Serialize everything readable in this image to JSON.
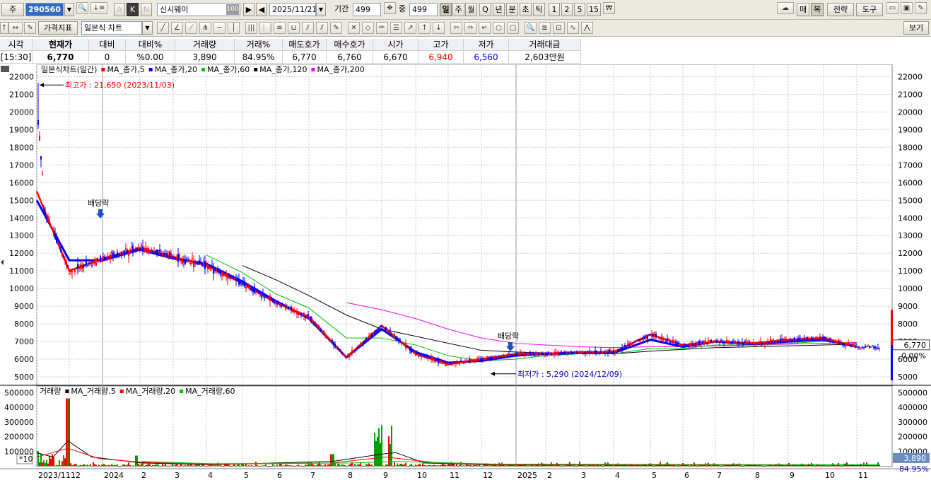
{
  "toolbar": {
    "market_label": "주",
    "symbol_code": "290560",
    "stock_name": "신시웨이",
    "stock_name_badge": "100",
    "date": "2025/11/21",
    "period_label": "기간",
    "period_value": "499",
    "zoom_label": "중",
    "zoom_value": "499",
    "periods": [
      "일",
      "주",
      "월",
      "Q",
      "년",
      "분",
      "초",
      "틱",
      "1",
      "2",
      "5",
      "15"
    ],
    "active_period": "일",
    "letters": [
      "A",
      "K",
      "N"
    ],
    "right_buttons": [
      "매",
      "복",
      "전략",
      "도구"
    ],
    "price_indicator_label": "가격지표",
    "chart_type_label": "일본식 차트",
    "view_label": "보기"
  },
  "quote": {
    "headers": [
      "시각",
      "현재가",
      "대비",
      "대비%",
      "거래량",
      "거래%",
      "매도호가",
      "매수호가",
      "시가",
      "고가",
      "저가",
      "거래대금"
    ],
    "values": [
      "[15:30]",
      "6,770",
      "0",
      "%0.00",
      "3,890",
      "84.95%",
      "6,770",
      "6,760",
      "6,670",
      "6,940",
      "6,560",
      "2,603만원"
    ]
  },
  "chart": {
    "price_legend": {
      "title": "일본식차트(일간)",
      "items": [
        {
          "label": "MA_종가,5",
          "color": "#ff0000"
        },
        {
          "label": "MA_종가,20",
          "color": "#0000ff"
        },
        {
          "label": "MA_종가,60",
          "color": "#00c000"
        },
        {
          "label": "MA_종가,120",
          "color": "#000000"
        },
        {
          "label": "MA_종가,200",
          "color": "#ff00ff"
        }
      ]
    },
    "volume_legend": {
      "title": "거래량",
      "items": [
        {
          "label": "MA_거래량,5",
          "color": "#000000"
        },
        {
          "label": "MA_거래량,20",
          "color": "#ff0000"
        },
        {
          "label": "MA_거래량,60",
          "color": "#00c000"
        }
      ]
    },
    "annotations": {
      "high": "최고가 : 21,650 (2023/11/03)",
      "low": "최저가 : 5,290 (2024/12/09)",
      "dividend": "배당락"
    },
    "last_price_label": "6,770",
    "change_label": "0.00%",
    "last_volume_label": "3,890",
    "volume_ratio_label": "84.95%",
    "volume_multiplier": "*10",
    "price_ticks": [
      22000,
      21000,
      20000,
      19000,
      18000,
      17000,
      16000,
      15000,
      14000,
      13000,
      12000,
      11000,
      10000,
      9000,
      8000,
      7000,
      6000,
      5000
    ],
    "volume_ticks": [
      "500000",
      "400000",
      "300000",
      "200000",
      "100000"
    ],
    "x_labels": [
      "2023/11",
      "12",
      "2024",
      "2",
      "3",
      "4",
      "5",
      "6",
      "7",
      "8",
      "9",
      "10",
      "11",
      "12",
      "2025",
      "2",
      "3",
      "4",
      "5",
      "6",
      "7",
      "8",
      "9",
      "10",
      "11"
    ]
  },
  "chart_data": {
    "type": "candlestick",
    "price_axis_range": [
      4600,
      22500
    ],
    "volume_axis_range": [
      0,
      540000
    ],
    "series": [
      {
        "name": "MA_종가,5",
        "points": [
          [
            "2023-11",
            15500
          ],
          [
            "2023-12",
            11000
          ],
          [
            "2024-01",
            11700
          ],
          [
            "2024-02",
            12300
          ],
          [
            "2024-03",
            11800
          ],
          [
            "2024-04",
            11300
          ],
          [
            "2024-05",
            10300
          ],
          [
            "2024-06",
            9200
          ],
          [
            "2024-07",
            8400
          ],
          [
            "2024-08",
            6100
          ],
          [
            "2024-09",
            7900
          ],
          [
            "2024-10",
            6300
          ],
          [
            "2024-11",
            5700
          ],
          [
            "2024-12",
            6000
          ],
          [
            "2025-01",
            6300
          ],
          [
            "2025-02",
            6300
          ],
          [
            "2025-03",
            6400
          ],
          [
            "2025-04",
            6400
          ],
          [
            "2025-05",
            7400
          ],
          [
            "2025-06",
            6800
          ],
          [
            "2025-07",
            7000
          ],
          [
            "2025-08",
            6900
          ],
          [
            "2025-09",
            7100
          ],
          [
            "2025-10",
            7200
          ],
          [
            "2025-11",
            6700
          ]
        ]
      },
      {
        "name": "MA_종가,20",
        "points": [
          [
            "2023-11",
            15000
          ],
          [
            "2023-12",
            11600
          ],
          [
            "2024-01",
            11600
          ],
          [
            "2024-02",
            12200
          ],
          [
            "2024-03",
            11700
          ],
          [
            "2024-04",
            11400
          ],
          [
            "2024-05",
            10400
          ],
          [
            "2024-06",
            9300
          ],
          [
            "2024-07",
            8300
          ],
          [
            "2024-08",
            6100
          ],
          [
            "2024-09",
            7700
          ],
          [
            "2024-10",
            6400
          ],
          [
            "2024-11",
            5800
          ],
          [
            "2024-12",
            5900
          ],
          [
            "2025-01",
            6200
          ],
          [
            "2025-02",
            6300
          ],
          [
            "2025-03",
            6350
          ],
          [
            "2025-04",
            6350
          ],
          [
            "2025-05",
            7100
          ],
          [
            "2025-06",
            6700
          ],
          [
            "2025-07",
            7000
          ],
          [
            "2025-08",
            6850
          ],
          [
            "2025-09",
            7000
          ],
          [
            "2025-10",
            7100
          ],
          [
            "2025-11",
            6700
          ]
        ]
      },
      {
        "name": "MA_종가,60",
        "points": [
          [
            "2024-04",
            11900
          ],
          [
            "2024-05",
            10900
          ],
          [
            "2024-06",
            9700
          ],
          [
            "2024-07",
            8900
          ],
          [
            "2024-08",
            7200
          ],
          [
            "2024-09",
            7200
          ],
          [
            "2024-10",
            6800
          ],
          [
            "2024-11",
            6200
          ],
          [
            "2024-12",
            5900
          ],
          [
            "2025-01",
            6000
          ],
          [
            "2025-02",
            6200
          ],
          [
            "2025-03",
            6300
          ],
          [
            "2025-04",
            6300
          ],
          [
            "2025-05",
            6600
          ],
          [
            "2025-06",
            6600
          ],
          [
            "2025-07",
            6800
          ],
          [
            "2025-08",
            6800
          ],
          [
            "2025-09",
            6900
          ],
          [
            "2025-10",
            7000
          ],
          [
            "2025-11",
            6900
          ]
        ]
      },
      {
        "name": "MA_종가,120",
        "points": [
          [
            "2024-05",
            11300
          ],
          [
            "2024-06",
            10500
          ],
          [
            "2024-07",
            9600
          ],
          [
            "2024-08",
            8500
          ],
          [
            "2024-09",
            7700
          ],
          [
            "2024-10",
            7300
          ],
          [
            "2024-11",
            6900
          ],
          [
            "2024-12",
            6500
          ],
          [
            "2025-01",
            6400
          ],
          [
            "2025-02",
            6350
          ],
          [
            "2025-03",
            6300
          ],
          [
            "2025-04",
            6300
          ],
          [
            "2025-05",
            6450
          ],
          [
            "2025-06",
            6550
          ],
          [
            "2025-07",
            6650
          ],
          [
            "2025-08",
            6700
          ],
          [
            "2025-09",
            6750
          ],
          [
            "2025-10",
            6800
          ],
          [
            "2025-11",
            6850
          ]
        ]
      },
      {
        "name": "MA_종가,200",
        "points": [
          [
            "2024-08",
            9200
          ],
          [
            "2024-09",
            8800
          ],
          [
            "2024-10",
            8300
          ],
          [
            "2024-11",
            7700
          ],
          [
            "2024-12",
            7200
          ],
          [
            "2025-01",
            6900
          ],
          [
            "2025-02",
            6800
          ],
          [
            "2025-03",
            6700
          ],
          [
            "2025-04",
            6650
          ],
          [
            "2025-05",
            6700
          ],
          [
            "2025-06",
            6700
          ],
          [
            "2025-07",
            6750
          ],
          [
            "2025-08",
            6800
          ],
          [
            "2025-09",
            6850
          ],
          [
            "2025-10",
            6900
          ],
          [
            "2025-11",
            6950
          ]
        ]
      }
    ]
  },
  "colors": {
    "up": "#ff0000",
    "down": "#0000ff",
    "grid": "#bdbdbd",
    "toolbar_bg": "#ece9e0"
  }
}
